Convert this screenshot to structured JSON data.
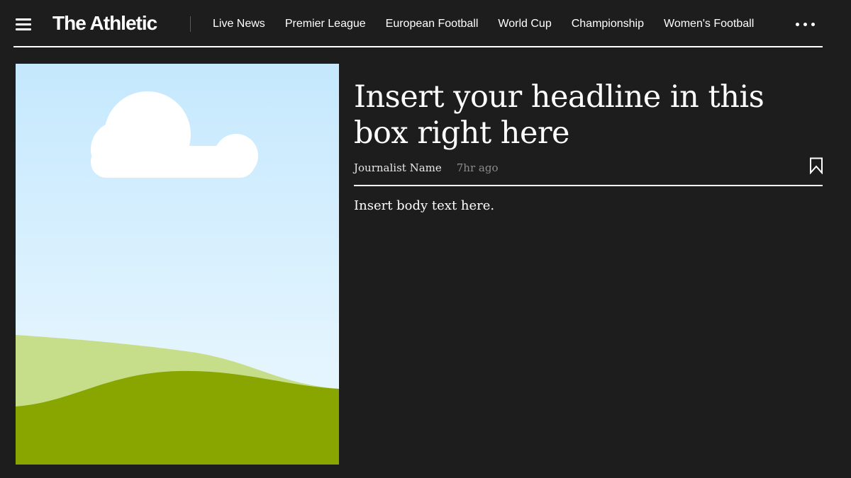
{
  "header": {
    "logo_text": "The Athletic",
    "menu_icon": "hamburger-menu-icon",
    "more_icon": "more-dots-icon",
    "nav": [
      {
        "label": "Live News"
      },
      {
        "label": "Premier League"
      },
      {
        "label": "European Football"
      },
      {
        "label": "World Cup"
      },
      {
        "label": "Championship"
      },
      {
        "label": "Women's Football"
      }
    ]
  },
  "article": {
    "headline": "Insert your headline in this box right here",
    "author": "Journalist Name",
    "timestamp": "7hr ago",
    "bookmark_icon": "bookmark-icon",
    "body": "Insert body text here.",
    "hero_image": {
      "kind": "placeholder landscape illustration",
      "sky_top_color": "#c5e8fd",
      "sky_bottom_color": "#eef9ff",
      "cloud_color": "#ffffff",
      "back_hill_color": "#c6de8a",
      "front_hill_color": "#88a500"
    }
  },
  "colors": {
    "background": "#1d1d1d",
    "text": "#ffffff",
    "muted_text": "#8c8c8c",
    "divider": "#5a5a5a"
  }
}
